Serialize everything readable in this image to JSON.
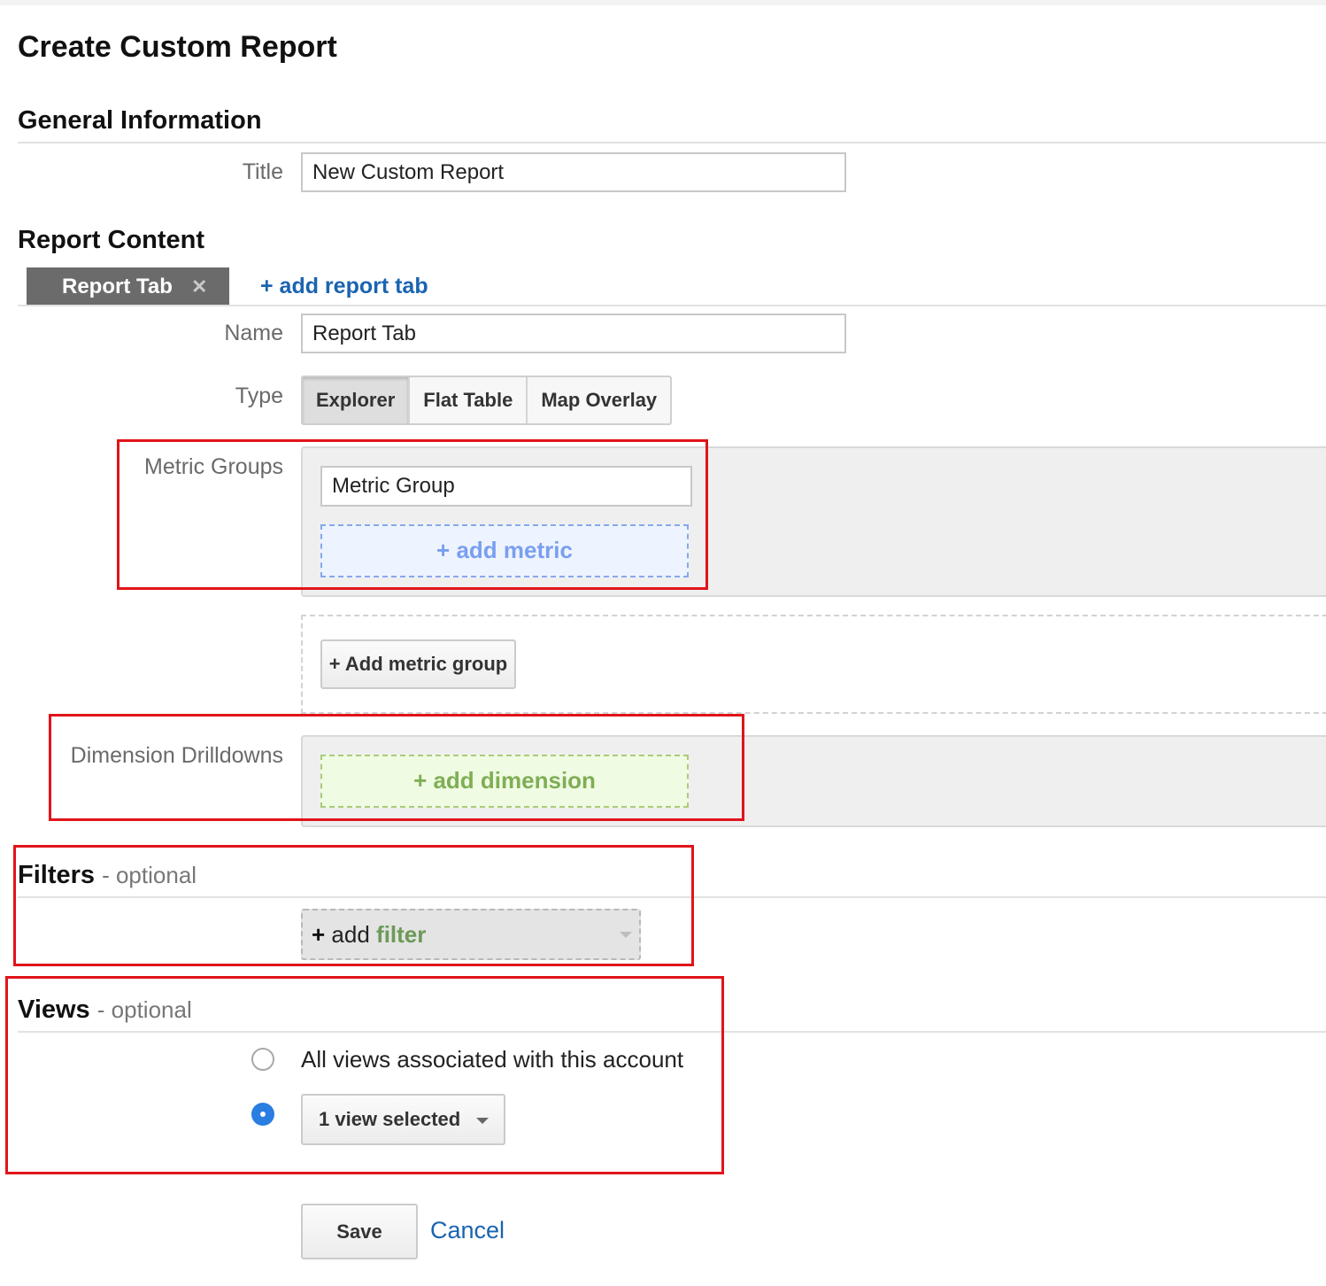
{
  "page": {
    "title": "Create Custom Report"
  },
  "general_information": {
    "heading": "General Information",
    "title_label": "Title",
    "title_value": "New Custom Report"
  },
  "report_content": {
    "heading": "Report Content",
    "active_tab_label": "Report Tab",
    "add_tab_link": "+ add report tab",
    "name_label": "Name",
    "name_value": "Report Tab",
    "type_label": "Type",
    "type_options": [
      "Explorer",
      "Flat Table",
      "Map Overlay"
    ],
    "type_selected": "Explorer",
    "metric_groups_label": "Metric Groups",
    "metric_group_value": "Metric Group",
    "add_metric": "+ add metric",
    "add_metric_group": "+ Add metric group",
    "dimension_drilldowns_label": "Dimension Drilldowns",
    "add_dimension": "+ add dimension"
  },
  "filters": {
    "heading": "Filters",
    "optional": "- optional",
    "add_prefix": "+ add",
    "add_word": "filter"
  },
  "views": {
    "heading": "Views",
    "optional": "- optional",
    "option_all": "All views associated with this account",
    "option_selected": "1 view selected",
    "selected_index": 1
  },
  "actions": {
    "save": "Save",
    "cancel": "Cancel"
  },
  "colors": {
    "link": "#1a64b0",
    "highlight_box": "#e0141a",
    "radio_selected": "#2a7de1",
    "metric_accent": "#7a9ff0",
    "dimension_accent": "#7fae55",
    "filter_accent": "#6c9a58"
  }
}
